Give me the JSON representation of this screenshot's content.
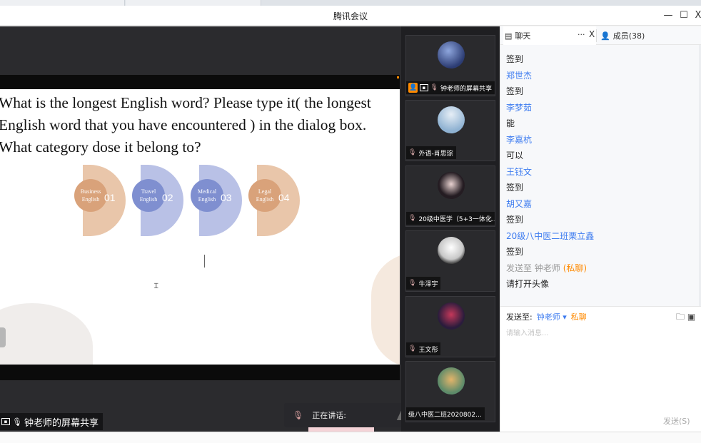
{
  "window": {
    "title": "腾讯会议",
    "minimize": "—",
    "maximize": "☐",
    "close": "X"
  },
  "slide": {
    "question_lines": [
      "What is the longest English word? Please type it( the  longest",
      "English word that you have encountered ) in the dialog box.",
      "What category dose it belong to?"
    ],
    "categories": [
      {
        "label_1": "Business",
        "label_2": "English",
        "num": "01",
        "color": "#d9a27a",
        "arc": "#e9c6aa"
      },
      {
        "label_1": "Travel",
        "label_2": "English",
        "num": "02",
        "color": "#7f8fd0",
        "arc": "#b9c1e6"
      },
      {
        "label_1": "Medical",
        "label_2": "English",
        "num": "03",
        "color": "#7f8fd0",
        "arc": "#b9c1e6"
      },
      {
        "label_1": "Legal",
        "label_2": "English",
        "num": "04",
        "color": "#d9a27a",
        "arc": "#e9c6aa"
      }
    ]
  },
  "stage": {
    "sharer_label": "钟老师的屏幕共享",
    "speaking_label": "正在讲话:"
  },
  "participants": [
    {
      "name": "钟老师的屏幕共享",
      "avatar_color": "#3a4f8c",
      "sharing": true
    },
    {
      "name": "外语-肖思琮",
      "avatar_color": "#9cc0dd",
      "sharing": false
    },
    {
      "name": "20级中医学（5+3一体化...",
      "avatar_color": "#2a2228",
      "sharing": false
    },
    {
      "name": "牛泽宇",
      "avatar_color": "#e6e6e6",
      "sharing": false
    },
    {
      "name": "王文彤",
      "avatar_color": "#5a1f3a",
      "sharing": false
    },
    {
      "name": "级八中医二班2020802...",
      "avatar_color": "#7aa07a",
      "sharing": false
    }
  ],
  "chat": {
    "tab_chat": "聊天",
    "tab_members": "成员(38)",
    "dots": "···",
    "close": "X",
    "messages": [
      {
        "type": "text",
        "text": "签到"
      },
      {
        "type": "name",
        "text": "郑世杰"
      },
      {
        "type": "text",
        "text": "签到"
      },
      {
        "type": "name",
        "text": "李梦茹"
      },
      {
        "type": "text",
        "text": "能"
      },
      {
        "type": "name",
        "text": "李嘉杭"
      },
      {
        "type": "text",
        "text": "可以"
      },
      {
        "type": "name",
        "text": "王钰文"
      },
      {
        "type": "text",
        "text": "签到"
      },
      {
        "type": "name",
        "text": "胡又嘉"
      },
      {
        "type": "text",
        "text": "签到"
      },
      {
        "type": "name",
        "text": "20级八中医二班栗立鑫"
      },
      {
        "type": "text",
        "text": "签到"
      }
    ],
    "private_line": {
      "prefix": "发送至",
      "who": "钟老师",
      "tag": "(私聊)"
    },
    "last_message": "请打开头像",
    "compose": {
      "to_label": "发送至:",
      "to_who": "钟老师 ▾",
      "to_priv": "私聊",
      "placeholder": "请输入消息...",
      "send": "发送(S)"
    }
  }
}
